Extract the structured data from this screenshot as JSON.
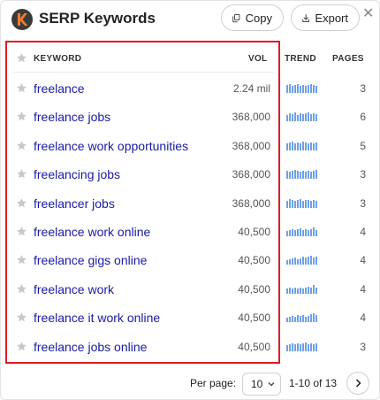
{
  "header": {
    "title": "SERP Keywords",
    "copy_label": "Copy",
    "export_label": "Export",
    "close_glyph": "✕",
    "logo_icon": "keywords-everywhere-logo-icon"
  },
  "table": {
    "headers": {
      "keyword": "KEYWORD",
      "vol": "VOL",
      "trend": "TREND",
      "pages": "PAGES"
    },
    "rows": [
      {
        "keyword": "freelance",
        "vol": "2.24 mil",
        "pages": "3",
        "trend": [
          0.9,
          1,
          0.8,
          0.9,
          1,
          0.8,
          0.9,
          0.8,
          0.9,
          1,
          0.9,
          0.8
        ]
      },
      {
        "keyword": "freelance jobs",
        "vol": "368,000",
        "pages": "6",
        "trend": [
          0.7,
          0.9,
          0.8,
          1,
          0.7,
          0.9,
          0.8,
          0.9,
          1,
          0.8,
          0.9,
          0.8
        ]
      },
      {
        "keyword": "freelance work opportunities",
        "vol": "368,000",
        "pages": "5",
        "trend": [
          0.8,
          0.9,
          1,
          0.8,
          0.9,
          0.8,
          1,
          0.9,
          0.8,
          0.9,
          0.8,
          0.9
        ]
      },
      {
        "keyword": "freelancing jobs",
        "vol": "368,000",
        "pages": "3",
        "trend": [
          0.9,
          0.8,
          0.9,
          1,
          0.9,
          0.8,
          0.9,
          0.8,
          0.9,
          0.8,
          0.9,
          1
        ]
      },
      {
        "keyword": "freelancer jobs",
        "vol": "368,000",
        "pages": "3",
        "trend": [
          0.8,
          1,
          0.9,
          0.8,
          0.9,
          1,
          0.8,
          0.9,
          0.9,
          0.8,
          0.9,
          0.8
        ]
      },
      {
        "keyword": "freelance work online",
        "vol": "40,500",
        "pages": "4",
        "trend": [
          0.6,
          0.7,
          0.8,
          0.7,
          0.8,
          0.9,
          0.7,
          0.8,
          0.7,
          0.8,
          1,
          0.7
        ]
      },
      {
        "keyword": "freelance gigs online",
        "vol": "40,500",
        "pages": "4",
        "trend": [
          0.5,
          0.6,
          0.7,
          0.8,
          0.6,
          0.7,
          0.9,
          0.8,
          0.9,
          1,
          0.8,
          0.9
        ]
      },
      {
        "keyword": "freelance work",
        "vol": "40,500",
        "pages": "4",
        "trend": [
          0.6,
          0.7,
          0.6,
          0.7,
          0.6,
          0.7,
          0.6,
          0.7,
          0.8,
          0.7,
          1,
          0.7
        ]
      },
      {
        "keyword": "freelance it work online",
        "vol": "40,500",
        "pages": "4",
        "trend": [
          0.5,
          0.6,
          0.7,
          0.6,
          0.8,
          0.7,
          0.8,
          0.6,
          0.7,
          0.9,
          1,
          0.8
        ]
      },
      {
        "keyword": "freelance jobs online",
        "vol": "40,500",
        "pages": "3",
        "trend": [
          0.7,
          0.8,
          0.9,
          0.8,
          0.9,
          0.8,
          0.9,
          1,
          0.8,
          0.9,
          0.8,
          0.9
        ]
      }
    ]
  },
  "footer": {
    "per_page_label": "Per page:",
    "per_page_value": "10",
    "range_text": "1-10 of 13"
  },
  "colors": {
    "keyword_link": "#1a1aa6",
    "trend_bar": "#6fa0e8",
    "highlight_box": "#e01b24",
    "star": "#c8c8c8"
  }
}
